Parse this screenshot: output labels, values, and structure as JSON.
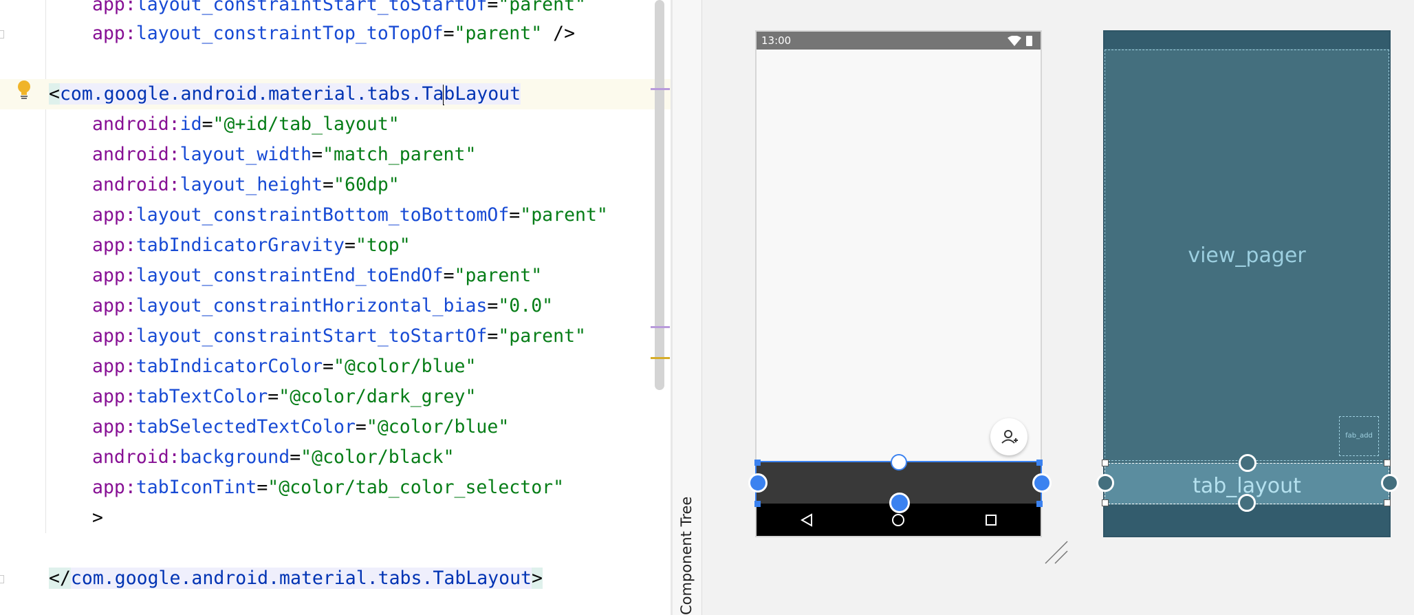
{
  "editor": {
    "lines": {
      "l1": {
        "prefix": "app:",
        "attr": "layout_constraintStart_toStartOf",
        "eq": "=",
        "value": "\"parent\""
      },
      "l2": {
        "prefix": "app:",
        "attr": "layout_constraintTop_toTopOf",
        "eq": "=",
        "value": "\"parent\"",
        "close": " />"
      },
      "open_tag": {
        "lt": "<",
        "name_before_caret": "com.google.android.material.tabs.Ta",
        "name_after_caret": "bLayout"
      },
      "a1": {
        "prefix": "android:",
        "attr": "id",
        "eq": "=",
        "value": "\"@+id/tab_layout\""
      },
      "a2": {
        "prefix": "android:",
        "attr": "layout_width",
        "eq": "=",
        "value": "\"match_parent\""
      },
      "a3": {
        "prefix": "android:",
        "attr": "layout_height",
        "eq": "=",
        "value": "\"60dp\""
      },
      "a4": {
        "prefix": "app:",
        "attr": "layout_constraintBottom_toBottomOf",
        "eq": "=",
        "value": "\"parent\""
      },
      "a5": {
        "prefix": "app:",
        "attr": "tabIndicatorGravity",
        "eq": "=",
        "value": "\"top\""
      },
      "a6": {
        "prefix": "app:",
        "attr": "layout_constraintEnd_toEndOf",
        "eq": "=",
        "value": "\"parent\""
      },
      "a7": {
        "prefix": "app:",
        "attr": "layout_constraintHorizontal_bias",
        "eq": "=",
        "value": "\"0.0\""
      },
      "a8": {
        "prefix": "app:",
        "attr": "layout_constraintStart_toStartOf",
        "eq": "=",
        "value": "\"parent\""
      },
      "a9": {
        "prefix": "app:",
        "attr": "tabIndicatorColor",
        "eq": "=",
        "value": "\"@color/blue\""
      },
      "a10": {
        "prefix": "app:",
        "attr": "tabTextColor",
        "eq": "=",
        "value": "\"@color/dark_grey\""
      },
      "a11": {
        "prefix": "app:",
        "attr": "tabSelectedTextColor",
        "eq": "=",
        "value": "\"@color/blue\""
      },
      "a12": {
        "prefix": "android:",
        "attr": "background",
        "eq": "=",
        "value": "\"@color/black\""
      },
      "a13": {
        "prefix": "app:",
        "attr": "tabIconTint",
        "eq": "=",
        "value": "\"@color/tab_color_selector\""
      },
      "gt": ">",
      "close_tag": {
        "lt": "</",
        "name": "com.google.android.material.tabs.TabLayout",
        "gt": ">"
      }
    }
  },
  "side_panel": {
    "component_tree_label": "Component Tree"
  },
  "phone_preview": {
    "status_time": "13:00",
    "icons": {
      "wifi": "wifi-icon",
      "battery": "battery-icon",
      "fab": "add-person-icon",
      "back": "nav-back-icon",
      "home": "nav-home-icon",
      "recents": "nav-recents-icon"
    }
  },
  "blueprint": {
    "view_pager_label": "view_pager",
    "tab_layout_label": "tab_layout",
    "fab_label": "fab_add"
  },
  "colors": {
    "selection_blue": "#3b82f0",
    "blueprint_bg": "#446f7e",
    "tab_bar_bg": "#393939"
  }
}
